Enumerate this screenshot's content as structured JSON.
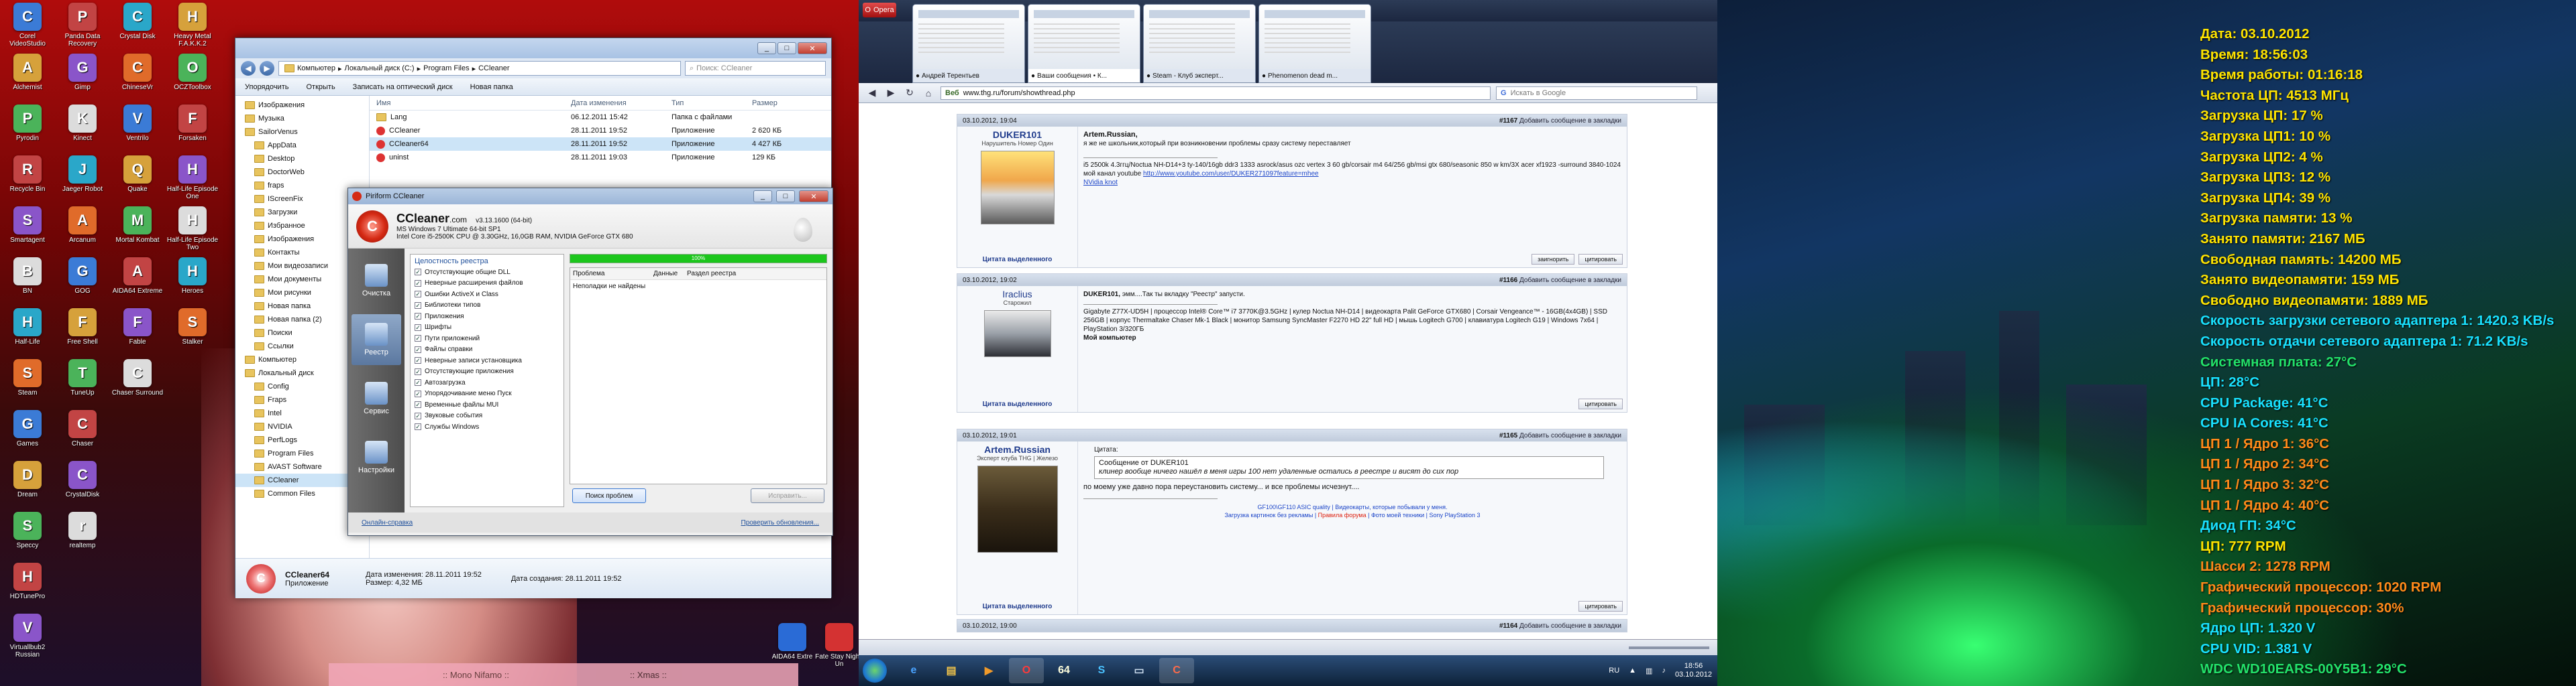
{
  "desktop": {
    "icons_col1": [
      "Corel VideoStudio",
      "Alchemist",
      "Pyrodin",
      "Recycle Bin",
      "Smartagent",
      "BN",
      "Half-Life",
      "Steam",
      "Games",
      "Dream",
      "Speccy",
      "HDTunePro",
      "Virtuallbub2 Russian"
    ],
    "icons_col2": [
      "Panda Data Recovery",
      "Gimp",
      "Kinect",
      "Jaeger Robot",
      "Arcanum",
      "GOG",
      "Free Shell",
      "TuneUp",
      "Chaser",
      "CrystalDisk",
      "realtemp"
    ],
    "icons_col3": [
      "Crystal Disk",
      "ChineseVr",
      "Ventrilo",
      "Quake",
      "Mortal Kombat",
      "AIDA64 Extreme",
      "Fable",
      "Chaser Surround"
    ],
    "icons_col4": [
      "Heavy Metal F.A.K.K.2",
      "OCZToolbox",
      "Forsaken",
      "Half-Life Episode One",
      "Half-Life Episode Two",
      "Heroes",
      "Stalker"
    ],
    "strip_left": ":: Mono Nifamo ::",
    "strip_right": ":: Xmas ::",
    "aida_tray_badge": "AIDA64 Extre",
    "fate_label": "Fate Stay Night: Un"
  },
  "explorer": {
    "breadcrumb": [
      "Компьютер",
      "Локальный диск (C:)",
      "Program Files",
      "CCleaner"
    ],
    "search_placeholder": "Поиск: CCleaner",
    "toolbar": [
      "Упорядочить",
      "Открыть",
      "Записать на оптический диск",
      "Новая папка"
    ],
    "tree": [
      "Изображения",
      "Музыка",
      "SailorVenus",
      "AppData",
      "Desktop",
      "DoctorWeb",
      "fraps",
      "IScreenFix",
      "Загрузки",
      "Избранное",
      "Изображения",
      "Контакты",
      "Мои видеозаписи",
      "Мои документы",
      "Мои рисунки",
      "Новая папка",
      "Новая папка (2)",
      "Поиски",
      "Ссылки",
      "Компьютер",
      "Локальный диск",
      "Config",
      "Fraps",
      "Intel",
      "NVIDIA",
      "PerfLogs",
      "Program Files",
      "AVAST Software",
      "CCleaner",
      "Common Files"
    ],
    "columns": [
      "Имя",
      "Дата изменения",
      "Тип",
      "Размер"
    ],
    "files": [
      {
        "name": "Lang",
        "date": "06.12.2011 15:42",
        "type": "Папка с файлами",
        "size": ""
      },
      {
        "name": "CCleaner",
        "date": "28.11.2011 19:52",
        "type": "Приложение",
        "size": "2 620 КБ"
      },
      {
        "name": "CCleaner64",
        "date": "28.11.2011 19:52",
        "type": "Приложение",
        "size": "4 427 КБ"
      },
      {
        "name": "uninst",
        "date": "28.11.2011 19:03",
        "type": "Приложение",
        "size": "129 КБ"
      }
    ],
    "details": {
      "name": "CCleaner64",
      "type": "Приложение",
      "modified_label": "Дата изменения:",
      "modified": "28.11.2011 19:52",
      "created_label": "Дата создания:",
      "created": "28.11.2011 19:52",
      "size_label": "Размер:",
      "size": "4,32 МБ"
    }
  },
  "ccleaner": {
    "window_title": "Piriform CCleaner",
    "brand": "CCleaner",
    "brand_suffix": ".com",
    "version": "v3.13.1600 (64-bit)",
    "sysinfo1": "MS Windows 7 Ultimate 64-bit SP1",
    "sysinfo2": "Intel Core i5-2500K CPU @ 3.30GHz, 16,0GB RAM, NVIDIA GeForce GTX 680",
    "nav": [
      "Очистка",
      "Реестр",
      "Сервис",
      "Настройки"
    ],
    "section": "Целостность реестра",
    "options": [
      "Отсутствующие общие DLL",
      "Неверные расширения файлов",
      "Ошибки ActiveX и Class",
      "Библиотеки типов",
      "Приложения",
      "Шрифты",
      "Пути приложений",
      "Файлы справки",
      "Неверные записи установщика",
      "Отсутствующие приложения",
      "Автозагрузка",
      "Упорядочивание меню Пуск",
      "Временные файлы MUI",
      "Звуковые события",
      "Службы Windows"
    ],
    "progress_label": "100%",
    "progress": 1.0,
    "result_cols": [
      "Проблема",
      "Данные",
      "Раздел реестра"
    ],
    "result_text": "Неполадки не найдены",
    "scan_button": "Поиск проблем",
    "fix_button": "Исправить...",
    "help_link": "Онлайн-справка",
    "update_link": "Проверить обновления..."
  },
  "opera": {
    "menu_label": "Opera",
    "tabs": [
      "Андрей Терентьев",
      "Ваши сообщения • К...",
      "Steam - Клуб эксперт...",
      "Phenomenon dead m..."
    ],
    "url_prefix": "Веб",
    "url": "www.thg.ru/forum/showthread.php",
    "search_placeholder": "Искать в Google",
    "posts": [
      {
        "date": "03.10.2012, 19:04",
        "num": "#1167",
        "bookmark": "Добавить сообщение в закладки",
        "user": "DUKER101",
        "title": "Нарушитель Номер Один",
        "quote_label": "Цитата выделенного",
        "author": "Artem.Russian,",
        "text": "я же не школьник,который при возникновении проблемы сразу систему переставляет",
        "spec": "i5 2500k 4.3ггц/Noctua NH-D14+3 ty-140/16gb ddr3 1333 asrock/asus ozc vertex 3 60 gb/corsair m4 64/256 gb/msi gtx 680/seasonic 850 w km/3X acer xf1923 -surround 3840-1024",
        "spec2": "мой канал youtube",
        "link": "http://www.youtube.com/user/DUKER271097feature=mhee",
        "link2": "NVidia knot",
        "actions": [
          "заигнорить",
          "цитировать"
        ]
      },
      {
        "date": "03.10.2012, 19:02",
        "num": "#1166",
        "bookmark": "Добавить сообщение в закладки",
        "user": "Iraclius",
        "title": "Старожил",
        "quote_label": "Цитата выделенного",
        "author": "DUKER101,",
        "text": "эмм....Так ты вкладку \"Реестр\" запусти.",
        "spec": "Gigabyte Z77X-UD5H | процессор Intel® Core™ i7 3770K@3.5GHz | кулер Noctua NH-D14 | видеокарта Palit GeForce GTX680 | Corsair Vengeance™ - 16GB(4x4GB) | SSD 256GB | корпус Thermaltake Chaser Mk-1 Black | монитор Samsung SyncMaster F2270 HD 22\" full HD | мышь Logitech G700 | клавиатура Logitech G19 | Windows 7x64 | PlayStation 3/320ГБ",
        "spec2": "Мой компьютер",
        "actions": [
          "цитировать"
        ]
      },
      {
        "date": "03.10.2012, 19:01",
        "num": "#1165",
        "bookmark": "Добавить сообщение в закладки",
        "user": "Artem.Russian",
        "title": "Эксперт клуба THG | Железо",
        "quote_label": "Цитата выделенного",
        "quote_head": "Цитата:",
        "quote_from": "Сообщение от DUKER101",
        "quote_text": "клинер вообще ничего нашёл в меня игры 100 нет удаленные остались в реестре и висят до сих пор",
        "text": "по моему уже давно пора переустановить систему... и все проблемы исчезнут....",
        "sig1": "GF100\\GF110 ASIC quality | Видеокарты, которые побывали у меня.",
        "sig2": "Загрузка картинок без рекламы",
        "sig3": "Правила форума",
        "sig4": "Фото моей техники | Sony PlayStation 3",
        "actions": [
          "цитировать"
        ]
      },
      {
        "date": "03.10.2012, 19:00",
        "num": "#1164",
        "bookmark": "Добавить сообщение в закладки"
      }
    ],
    "clock_time": "18:56",
    "clock_date": "03.10.2012",
    "lang": "RU"
  },
  "aida": {
    "lines": [
      {
        "text": "Дата: 03.10.2012",
        "cls": "y"
      },
      {
        "text": "Время: 18:56:03",
        "cls": "y"
      },
      {
        "text": "Время работы: 01:16:18",
        "cls": "y"
      },
      {
        "text": "Частота ЦП: 4513 МГц",
        "cls": "y"
      },
      {
        "text": "Загрузка ЦП: 17 %",
        "cls": "y"
      },
      {
        "text": "Загрузка ЦП1: 10 %",
        "cls": "y"
      },
      {
        "text": "Загрузка ЦП2: 4 %",
        "cls": "y"
      },
      {
        "text": "Загрузка ЦП3: 12 %",
        "cls": "y"
      },
      {
        "text": "Загрузка ЦП4: 39 %",
        "cls": "y"
      },
      {
        "text": "Загрузка памяти: 13 %",
        "cls": "y"
      },
      {
        "text": "Занято памяти: 2167 МБ",
        "cls": "y"
      },
      {
        "text": "Свободная память: 14200 МБ",
        "cls": "y"
      },
      {
        "text": "Занято видеопамяти: 159 МБ",
        "cls": "y"
      },
      {
        "text": "Свободно видеопамяти: 1889 МБ",
        "cls": "y"
      },
      {
        "text": "Скорость загрузки сетевого адаптера 1: 1420.3 KB/s",
        "cls": "c"
      },
      {
        "text": "Скорость отдачи сетевого адаптера 1: 71.2 KB/s",
        "cls": "c"
      },
      {
        "text": "Системная плата: 27°C",
        "cls": "g"
      },
      {
        "text": "ЦП: 28°C",
        "cls": "c"
      },
      {
        "text": "CPU Package: 41°C",
        "cls": "c"
      },
      {
        "text": "CPU IA Cores: 41°C",
        "cls": "c"
      },
      {
        "text": "ЦП 1 / Ядро 1: 36°C",
        "cls": "o"
      },
      {
        "text": "ЦП 1 / Ядро 2: 34°C",
        "cls": "o"
      },
      {
        "text": "ЦП 1 / Ядро 3: 32°C",
        "cls": "o"
      },
      {
        "text": "ЦП 1 / Ядро 4: 40°C",
        "cls": "o"
      },
      {
        "text": "Диод ГП: 34°C",
        "cls": "c"
      },
      {
        "text": "ЦП: 777 RPM",
        "cls": "y"
      },
      {
        "text": "Шасси 2: 1278 RPM",
        "cls": "o"
      },
      {
        "text": "Графический процессор: 1020 RPM",
        "cls": "o"
      },
      {
        "text": "Графический процессор: 30%",
        "cls": "o"
      },
      {
        "text": "Ядро ЦП: 1.320 V",
        "cls": "c"
      },
      {
        "text": "CPU VID: 1.381 V",
        "cls": "c"
      },
      {
        "text": "WDC WD10EARS-00Y5B1: 29°C",
        "cls": "g"
      }
    ]
  }
}
